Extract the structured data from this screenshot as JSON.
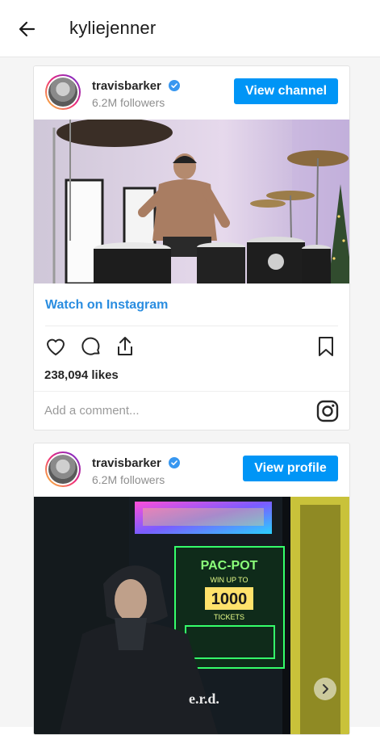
{
  "header": {
    "title": "kyliejenner",
    "back_icon": "arrow-left-icon"
  },
  "posts": [
    {
      "username": "travisbarker",
      "followers": "6.2M followers",
      "button_label": "View channel",
      "watch_label": "Watch on Instagram",
      "likes": "238,094 likes",
      "comment_placeholder": "Add a comment..."
    },
    {
      "username": "travisbarker",
      "followers": "6.2M followers",
      "button_label": "View profile"
    }
  ],
  "colors": {
    "accent": "#0095f6",
    "link": "#2a8de0",
    "text": "#262626",
    "muted": "#8e8e8e"
  },
  "arcade_sign": {
    "line1": "PAC-POT",
    "line2": "WIN UP TO",
    "line3": "1000",
    "line4": "TICKETS"
  },
  "hoodie_text": "e.r.d."
}
